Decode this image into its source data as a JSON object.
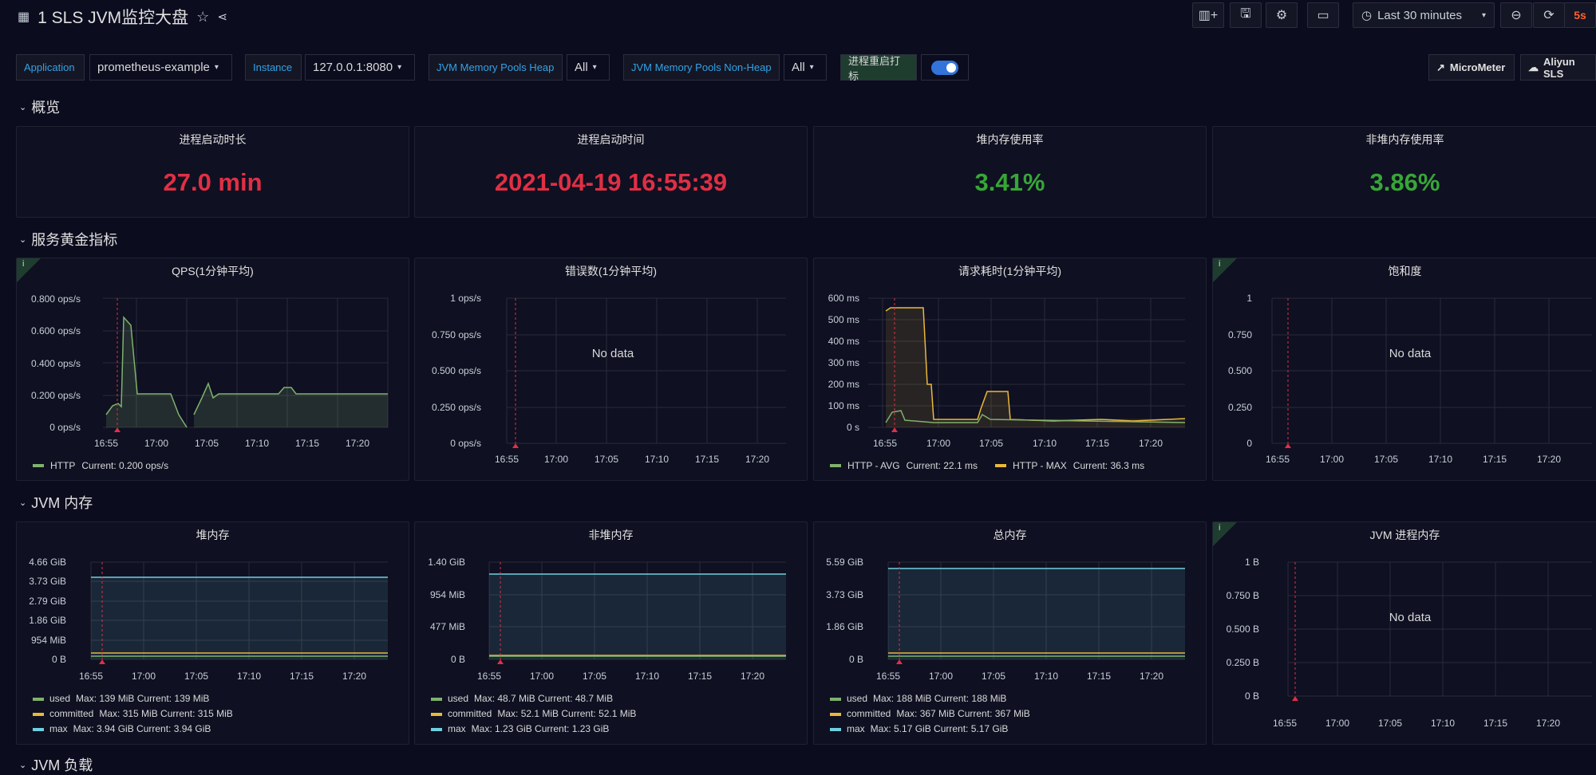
{
  "header": {
    "title": "1 SLS JVM监控大盘",
    "time_range": "Last 30 minutes",
    "refresh": "5s"
  },
  "variables": {
    "application_label": "Application",
    "application_value": "prometheus-example",
    "instance_label": "Instance",
    "instance_value": "127.0.0.1:8080",
    "heap_label": "JVM Memory Pools Heap",
    "heap_value": "All",
    "nonheap_label": "JVM Memory Pools Non-Heap",
    "nonheap_value": "All",
    "restart_label": "进程重启打标",
    "link_micrometer": "MicroMeter",
    "link_aliyun": "Aliyun SLS"
  },
  "rows": {
    "overview": "概览",
    "golden": "服务黄金指标",
    "jvm_memory": "JVM 内存",
    "jvm_load": "JVM 负载"
  },
  "stats": [
    {
      "title": "进程启动时长",
      "value": "27.0 min",
      "color": "#e02f44"
    },
    {
      "title": "进程启动时间",
      "value": "2021-04-19 16:55:39",
      "color": "#e02f44"
    },
    {
      "title": "堆内存使用率",
      "value": "3.41%",
      "color": "#37a637"
    },
    {
      "title": "非堆内存使用率",
      "value": "3.86%",
      "color": "#37a637"
    }
  ],
  "colors": {
    "green": "#7eb26d",
    "yellow": "#eab839",
    "blue": "#6ed0e0",
    "annotation": "#e02f44"
  },
  "icon_info": "i",
  "no_data": "No data",
  "x_ticks": [
    "16:55",
    "17:00",
    "17:05",
    "17:10",
    "17:15",
    "17:20"
  ],
  "golden": {
    "qps": {
      "title": "QPS(1分钟平均)",
      "y_ticks": [
        "0.800 ops/s",
        "0.600 ops/s",
        "0.400 ops/s",
        "0.200 ops/s",
        "0 ops/s"
      ],
      "legend": [
        {
          "name": "HTTP",
          "stat": "Current: 0.200 ops/s",
          "color": "#7eb26d"
        }
      ]
    },
    "errors": {
      "title": "错误数(1分钟平均)",
      "y_ticks": [
        "1 ops/s",
        "0.750 ops/s",
        "0.500 ops/s",
        "0.250 ops/s",
        "0 ops/s"
      ]
    },
    "latency": {
      "title": "请求耗时(1分钟平均)",
      "y_ticks": [
        "600 ms",
        "500 ms",
        "400 ms",
        "300 ms",
        "200 ms",
        "100 ms",
        "0 s"
      ],
      "legend": [
        {
          "name": "HTTP - AVG",
          "stat": "Current: 22.1 ms",
          "color": "#7eb26d"
        },
        {
          "name": "HTTP - MAX",
          "stat": "Current: 36.3 ms",
          "color": "#eab839"
        }
      ]
    },
    "saturation": {
      "title": "饱和度",
      "y_ticks": [
        "1",
        "0.750",
        "0.500",
        "0.250",
        "0"
      ]
    }
  },
  "memory": {
    "heap": {
      "title": "堆内存",
      "y_ticks": [
        "4.66 GiB",
        "3.73 GiB",
        "2.79 GiB",
        "1.86 GiB",
        "954 MiB",
        "0 B"
      ],
      "legend": [
        {
          "name": "used",
          "stat": "Max: 139 MiB  Current: 139 MiB",
          "color": "#7eb26d"
        },
        {
          "name": "committed",
          "stat": "Max: 315 MiB  Current: 315 MiB",
          "color": "#eab839"
        },
        {
          "name": "max",
          "stat": "Max: 3.94 GiB  Current: 3.94 GiB",
          "color": "#6ed0e0"
        }
      ]
    },
    "nonheap": {
      "title": "非堆内存",
      "y_ticks": [
        "1.40 GiB",
        "954 MiB",
        "477 MiB",
        "0 B"
      ],
      "legend": [
        {
          "name": "used",
          "stat": "Max: 48.7 MiB  Current: 48.7 MiB",
          "color": "#7eb26d"
        },
        {
          "name": "committed",
          "stat": "Max: 52.1 MiB  Current: 52.1 MiB",
          "color": "#eab839"
        },
        {
          "name": "max",
          "stat": "Max: 1.23 GiB  Current: 1.23 GiB",
          "color": "#6ed0e0"
        }
      ]
    },
    "total": {
      "title": "总内存",
      "y_ticks": [
        "5.59 GiB",
        "3.73 GiB",
        "1.86 GiB",
        "0 B"
      ],
      "legend": [
        {
          "name": "used",
          "stat": "Max: 188 MiB  Current: 188 MiB",
          "color": "#7eb26d"
        },
        {
          "name": "committed",
          "stat": "Max: 367 MiB  Current: 367 MiB",
          "color": "#eab839"
        },
        {
          "name": "max",
          "stat": "Max: 5.17 GiB  Current: 5.17 GiB",
          "color": "#6ed0e0"
        }
      ]
    },
    "process": {
      "title": "JVM 进程内存",
      "y_ticks": [
        "1 B",
        "0.750 B",
        "0.500 B",
        "0.250 B",
        "0 B"
      ]
    }
  },
  "chart_data": [
    {
      "type": "area",
      "title": "QPS(1分钟平均)",
      "x": [
        "16:53",
        "16:54",
        "16:55",
        "16:56",
        "16:57",
        "16:59",
        "17:00",
        "17:01",
        "17:03",
        "17:04",
        "17:05",
        "17:13",
        "17:14",
        "17:24"
      ],
      "series": [
        {
          "name": "HTTP",
          "values": [
            0.08,
            0.15,
            0.17,
            0.68,
            0.2,
            0.2,
            0.2,
            0.0,
            0.2,
            0.32,
            0.2,
            0.2,
            0.24,
            0.2
          ]
        }
      ],
      "ylim": [
        0,
        0.8
      ]
    },
    {
      "type": "line",
      "title": "请求耗时(1分钟平均)",
      "x": [
        "16:54",
        "16:55",
        "16:58",
        "16:59",
        "17:04",
        "17:05",
        "17:07",
        "17:08",
        "17:24"
      ],
      "series": [
        {
          "name": "HTTP - AVG",
          "values": [
            20,
            80,
            70,
            30,
            20,
            40,
            20,
            22,
            22
          ]
        },
        {
          "name": "HTTP - MAX",
          "values": [
            540,
            550,
            550,
            200,
            30,
            170,
            170,
            30,
            36
          ]
        }
      ],
      "ylim": [
        0,
        600
      ]
    },
    {
      "type": "area",
      "title": "堆内存",
      "series": [
        {
          "name": "used",
          "values": [
            0.136,
            0.136
          ]
        },
        {
          "name": "committed",
          "values": [
            0.31,
            0.31
          ]
        },
        {
          "name": "max",
          "values": [
            3.94,
            3.94
          ]
        }
      ],
      "x": [
        "16:53",
        "17:24"
      ],
      "ylim": [
        0,
        4.66
      ]
    },
    {
      "type": "area",
      "title": "非堆内存",
      "series": [
        {
          "name": "used",
          "values": [
            0.048,
            0.048
          ]
        },
        {
          "name": "committed",
          "values": [
            0.051,
            0.051
          ]
        },
        {
          "name": "max",
          "values": [
            1.23,
            1.23
          ]
        }
      ],
      "x": [
        "16:53",
        "17:24"
      ],
      "ylim": [
        0,
        1.4
      ]
    },
    {
      "type": "area",
      "title": "总内存",
      "series": [
        {
          "name": "used",
          "values": [
            0.18,
            0.18
          ]
        },
        {
          "name": "committed",
          "values": [
            0.36,
            0.36
          ]
        },
        {
          "name": "max",
          "values": [
            5.17,
            5.17
          ]
        }
      ],
      "x": [
        "16:53",
        "17:24"
      ],
      "ylim": [
        0,
        5.59
      ]
    }
  ]
}
